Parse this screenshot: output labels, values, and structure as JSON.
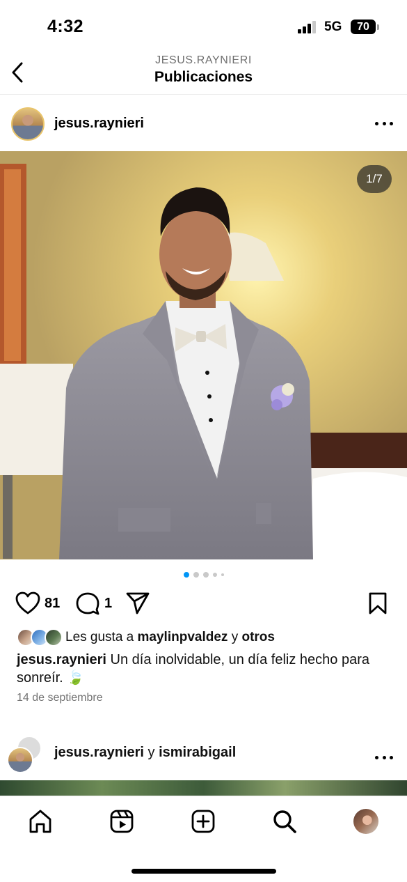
{
  "status_bar": {
    "time": "4:32",
    "network": "5G",
    "battery": "70"
  },
  "header": {
    "subtitle": "JESUS.RAYNIERI",
    "title": "Publicaciones"
  },
  "post": {
    "username": "jesus.raynieri",
    "photo_counter": "1/7",
    "like_count": "81",
    "comment_count": "1",
    "likes": {
      "prefix": "Les gusta a ",
      "user": "maylinpvaldez",
      "connector": " y ",
      "others": "otros"
    },
    "caption_user": "jesus.raynieri",
    "caption_text": " Un día inolvidable, un día feliz hecho para sonreír. 🍃",
    "date": "14 de septiembre"
  },
  "next_post": {
    "user1": "jesus.raynieri",
    "connector": " y ",
    "user2": "ismirabigail"
  },
  "colors": {
    "active_dot": "#0095f6",
    "inactive_dot": "#c9c9c9",
    "text_secondary": "#737373"
  },
  "icons": {
    "back": "chevron-left-icon",
    "more": "more-horizontal-icon",
    "like": "heart-icon",
    "comment": "comment-icon",
    "share": "paper-plane-icon",
    "save": "bookmark-icon",
    "home": "home-icon",
    "reels": "reels-icon",
    "create": "plus-square-icon",
    "search": "search-icon"
  }
}
